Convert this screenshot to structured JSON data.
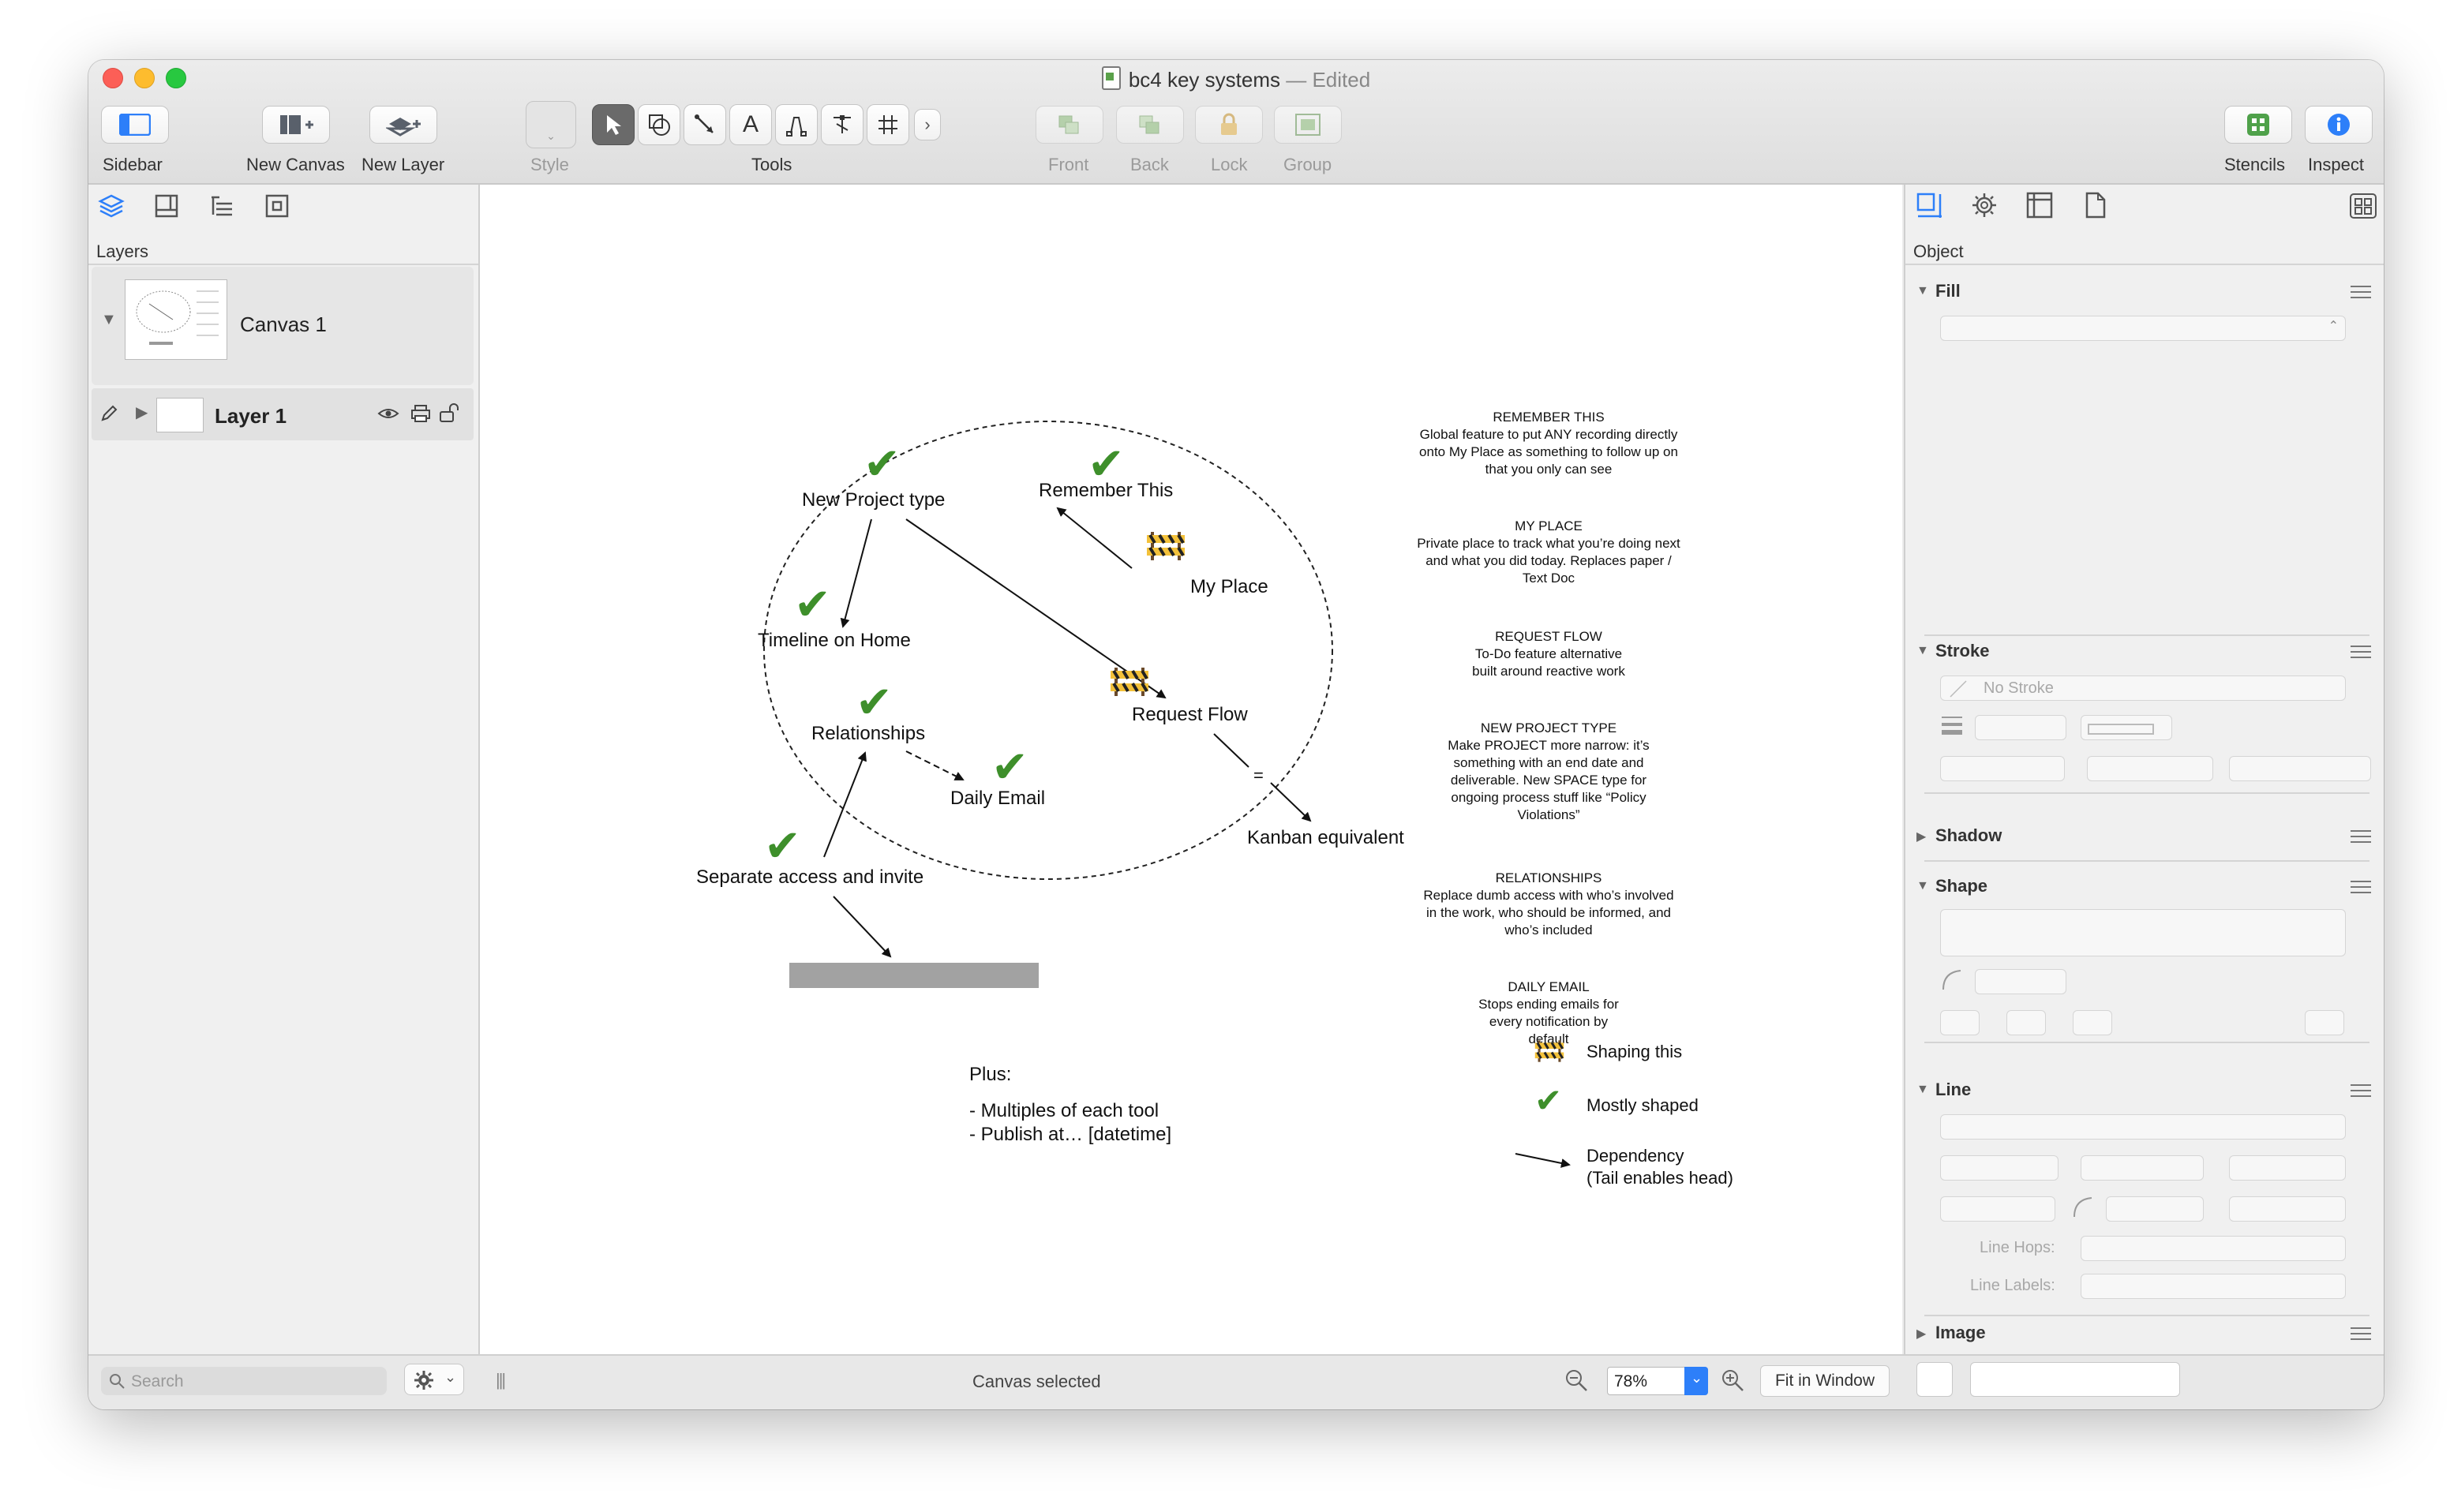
{
  "window": {
    "title": "bc4 key systems",
    "title_suffix": "— Edited"
  },
  "toolbar": {
    "sidebar_label": "Sidebar",
    "new_canvas_label": "New Canvas",
    "new_layer_label": "New Layer",
    "style_label": "Style",
    "tools_label": "Tools",
    "front_label": "Front",
    "back_label": "Back",
    "lock_label": "Lock",
    "group_label": "Group",
    "stencils_label": "Stencils",
    "inspect_label": "Inspect"
  },
  "left_sidebar": {
    "section_title": "Layers",
    "canvas_name": "Canvas 1",
    "layer_name": "Layer 1",
    "search_placeholder": "Search"
  },
  "diagram": {
    "nodes": {
      "new_project_type": "New Project type",
      "remember_this": "Remember This",
      "my_place": "My Place",
      "timeline_on_home": "Timeline on Home",
      "request_flow": "Request Flow",
      "relationships": "Relationships",
      "daily_email": "Daily Email",
      "separate_access": "Separate access and invite",
      "kanban": "Kanban equivalent",
      "equals": "="
    },
    "plus": {
      "heading": "Plus:",
      "line1": "- Multiples of each tool",
      "line2": "- Publish at… [datetime]"
    },
    "notes": [
      {
        "title": "REMEMBER THIS",
        "body": "Global feature to put ANY recording directly onto My Place as something to follow up on that you only can see"
      },
      {
        "title": "MY PLACE",
        "body": "Private place to track what you’re doing next and what you did today. Replaces paper / Text Doc"
      },
      {
        "title": "REQUEST FLOW",
        "body": "To-Do feature alternative built around reactive work"
      },
      {
        "title": "NEW PROJECT TYPE",
        "body": "Make PROJECT more narrow: it’s something with an end date and deliverable. New SPACE type for ongoing process stuff like “Policy Violations”"
      },
      {
        "title": "RELATIONSHIPS",
        "body": "Replace dumb access with who’s involved in the work, who should be informed, and who’s included"
      },
      {
        "title": "DAILY EMAIL",
        "body": "Stops ending emails for every notification by default"
      }
    ],
    "legend": {
      "shaping": "Shaping this",
      "mostly": "Mostly shaped",
      "dependency_line1": "Dependency",
      "dependency_line2": "(Tail enables head)"
    }
  },
  "inspector": {
    "tab_title": "Object",
    "fill": "Fill",
    "stroke": "Stroke",
    "no_stroke": "No Stroke",
    "shadow": "Shadow",
    "shape": "Shape",
    "line": "Line",
    "line_hops": "Line Hops:",
    "line_labels": "Line Labels:",
    "image": "Image"
  },
  "status": {
    "text": "Canvas selected",
    "zoom": "78%",
    "fit_button": "Fit in Window"
  },
  "colors": {
    "check_green": "#3e8f2b",
    "close": "#fc5f57",
    "minimize": "#fdbc2e",
    "zoom": "#28c840",
    "accent_blue": "#2d7ff9"
  }
}
